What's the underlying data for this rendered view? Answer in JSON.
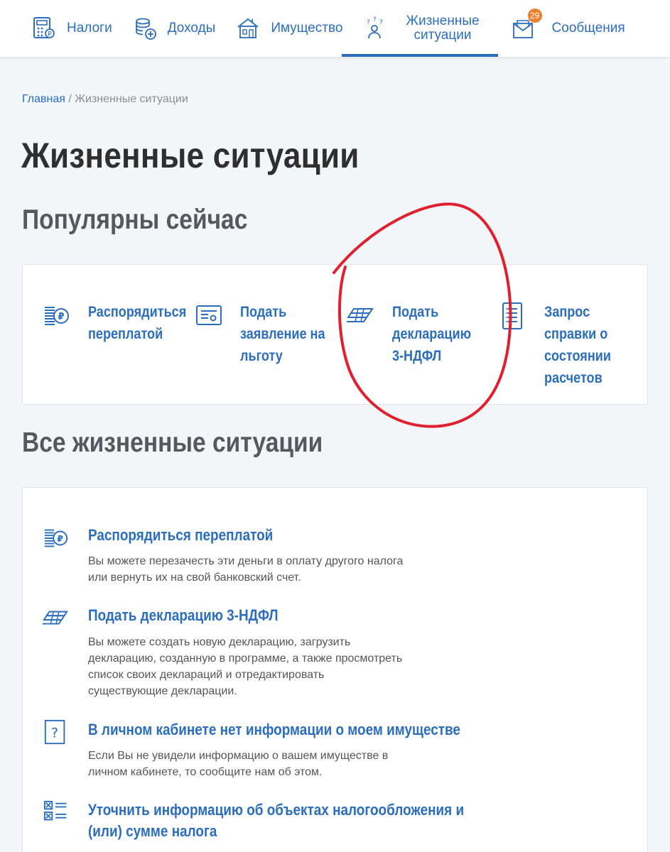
{
  "nav": {
    "items": [
      {
        "label": "Налоги"
      },
      {
        "label": "Доходы"
      },
      {
        "label": "Имущество"
      },
      {
        "label": "Жизненные\nситуации",
        "line1": "Жизненные",
        "line2": "ситуации"
      },
      {
        "label": "Сообщения",
        "badge": "29"
      }
    ]
  },
  "breadcrumb": {
    "home": "Главная",
    "separator": " / ",
    "current": "Жизненные ситуации"
  },
  "page_title": "Жизненные ситуации",
  "popular": {
    "title": "Популярны сейчас",
    "items": [
      {
        "lines": [
          "Распорядиться",
          "переплатой"
        ]
      },
      {
        "lines": [
          "Подать",
          "заявление на",
          "льготу"
        ]
      },
      {
        "lines": [
          "Подать",
          "декларацию",
          "3-НДФЛ"
        ]
      },
      {
        "lines": [
          "Запрос",
          "справки о",
          "состоянии",
          "расчетов"
        ]
      }
    ]
  },
  "all": {
    "title": "Все жизненные ситуации",
    "items": [
      {
        "title": "Распорядиться переплатой",
        "desc": [
          "Вы можете перезачесть эти деньги в оплату другого налога",
          "или вернуть их на свой банковский счет."
        ]
      },
      {
        "title": "Подать декларацию 3-НДФЛ",
        "desc": [
          "Вы можете создать новую декларацию, загрузить",
          "декларацию, созданную в программе, а также просмотреть",
          "список своих деклараций и отредактировать",
          "существующие декларации."
        ]
      },
      {
        "title": "В личном кабинете нет информации о моем имуществе",
        "desc": [
          "Если Вы не увидели информацию о вашем имуществе в",
          "личном кабинете, то сообщите нам об этом."
        ]
      },
      {
        "title_lines": [
          "Уточнить информацию об объектах налогообложения и",
          "(или) сумме налога"
        ]
      }
    ]
  },
  "colors": {
    "accent": "#2b6ebd",
    "badge": "#f07f2d",
    "annotation": "#e0202e",
    "background": "#f3f6f9"
  },
  "icons": [
    "calculator-icon",
    "coins-icon",
    "house-icon",
    "people-question-icon",
    "envelope-icon",
    "ruble-coins-icon",
    "certificate-icon",
    "declaration-stack-icon",
    "document-list-icon",
    "question-box-icon",
    "checklist-icon"
  ]
}
